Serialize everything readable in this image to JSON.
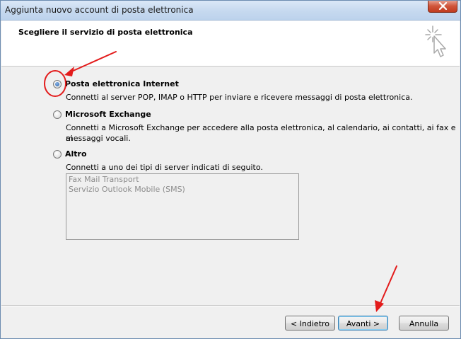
{
  "window": {
    "title": "Aggiunta nuovo account di posta elettronica"
  },
  "header": {
    "title": "Scegliere il servizio di posta elettronica"
  },
  "options": [
    {
      "label": "Posta elettronica Internet",
      "description": "Connetti al server POP, IMAP o HTTP per inviare e ricevere messaggi di posta elettronica.",
      "selected": true
    },
    {
      "label": "Microsoft Exchange",
      "description_line1": "Connetti a Microsoft Exchange per accedere alla posta elettronica, al calendario, ai contatti, ai fax e ai",
      "description_line2": "messaggi vocali.",
      "selected": false
    },
    {
      "label": "Altro",
      "description": "Connetti a uno dei tipi di server indicati di seguito.",
      "selected": false,
      "server_list": [
        "Fax Mail Transport",
        "Servizio Outlook Mobile (SMS)"
      ]
    }
  ],
  "buttons": {
    "back": "< Indietro",
    "next": "Avanti >",
    "cancel": "Annulla"
  },
  "colors": {
    "annotation": "#e31b1b",
    "radio_selected": "#1f5ea8"
  },
  "icons": {
    "close": "close-icon",
    "wizard": "cursor-sparkle-icon"
  }
}
